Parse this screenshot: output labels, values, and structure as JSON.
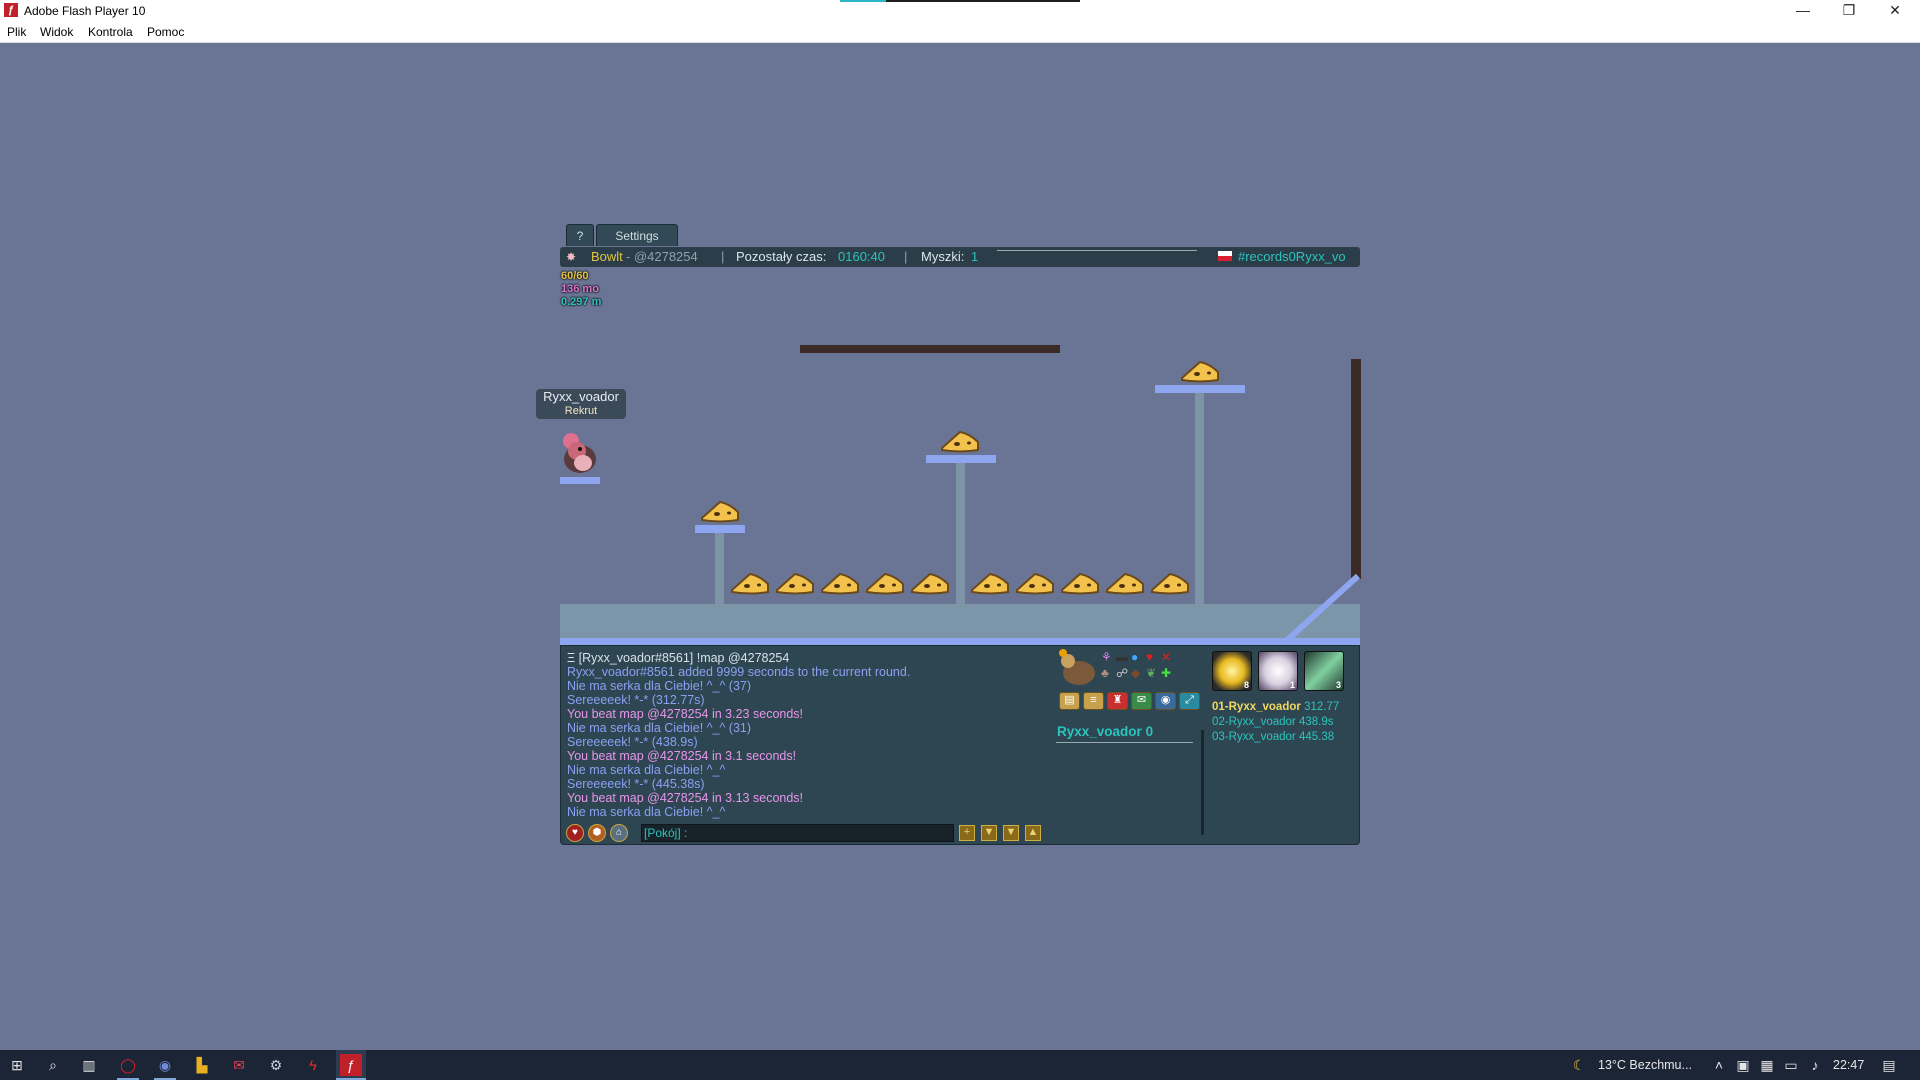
{
  "window": {
    "title": "Adobe Flash Player 10",
    "app_icon": "flash-icon",
    "controls": [
      "minimize-icon",
      "restore-icon",
      "close-icon"
    ],
    "menu": [
      "Plik",
      "Widok",
      "Kontrola",
      "Pomoc"
    ]
  },
  "game": {
    "tabs": {
      "help": "?",
      "settings": "Settings"
    },
    "infobar": {
      "map_author": "Bowlt",
      "map_code": " - @4278254",
      "sep": "|",
      "time_label": "Pozostały czas:",
      "time_value": "0160:40",
      "mice_label": "Myszki:",
      "mice_value": "1",
      "room": "#records0Ryxx_vo"
    },
    "stats": {
      "fps": "60/60",
      "memory": "136 mo",
      "distance": "0.297 m"
    },
    "player_tag": {
      "name": "Ryxx_voador",
      "rank": "Rekrut"
    },
    "chat": [
      {
        "text": "Ξ [Ryxx_voador#8561] !map @4278254",
        "color": "white"
      },
      {
        "text": "Ryxx_voador#8561 added 9999 seconds to the current round.",
        "color": "blue"
      },
      {
        "text": "Nie ma serka dla Ciebie! ^_^ (37)",
        "color": "blue"
      },
      {
        "text": "Sereeeeek! *-* (312.77s)",
        "color": "blue"
      },
      {
        "text": "You beat map @4278254 in 3.23 seconds!",
        "color": "pink"
      },
      {
        "text": "Nie ma serka dla Ciebie! ^_^ (31)",
        "color": "blue"
      },
      {
        "text": "Sereeeeek! *-* (438.9s)",
        "color": "blue"
      },
      {
        "text": "You beat map @4278254 in 3.1 seconds!",
        "color": "pink"
      },
      {
        "text": "Nie ma serka dla Ciebie! ^_^",
        "color": "blue"
      },
      {
        "text": "Sereeeeek! *-* (445.38s)",
        "color": "blue"
      },
      {
        "text": "You beat map @4278254 in 3.13 seconds!",
        "color": "pink"
      },
      {
        "text": "Nie ma serka dla Ciebie! ^_^",
        "color": "blue"
      }
    ],
    "chat_input": {
      "prefix": "[Pokój] :"
    },
    "player_score": {
      "name": "Ryxx_voador",
      "score": "0"
    },
    "badges": [
      {
        "icon": "sun-badge-icon",
        "count": "8"
      },
      {
        "icon": "bunny-badge-icon",
        "count": "1"
      },
      {
        "icon": "wand-badge-icon",
        "count": "3"
      }
    ],
    "ranking": [
      {
        "name": "01-Ryxx_voador",
        "time": "312.77"
      },
      {
        "name": "02-Ryxx_voador",
        "time": "438.9s"
      },
      {
        "name": "03-Ryxx_voador",
        "time": "445.38"
      }
    ]
  },
  "taskbar": {
    "weather": "13°C  Bezchmu...",
    "clock": "22:47"
  }
}
